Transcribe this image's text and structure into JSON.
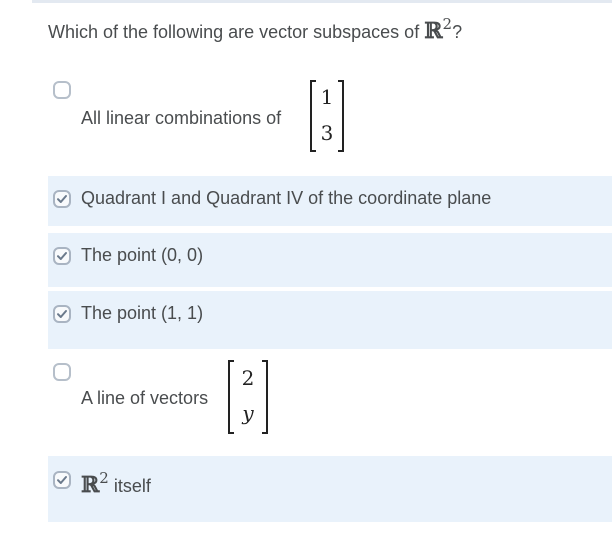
{
  "question": {
    "text": "Which of the following are vector subspaces of",
    "symbol": "ℝ",
    "exponent": "2",
    "suffix": "?"
  },
  "options": [
    {
      "label": "All linear combinations of",
      "checked": false,
      "selected": false,
      "vector": [
        "1",
        "3"
      ]
    },
    {
      "label": "Quadrant I and Quadrant IV of the coordinate plane",
      "checked": true,
      "selected": true
    },
    {
      "label": "The point (0, 0)",
      "checked": true,
      "selected": true
    },
    {
      "label": "The point (1, 1)",
      "checked": true,
      "selected": true
    },
    {
      "label": "A line of vectors",
      "checked": false,
      "selected": false,
      "vector": [
        "2",
        "y"
      ]
    },
    {
      "symbol": "ℝ",
      "exponent": "2",
      "label": "itself",
      "checked": true,
      "selected": true
    }
  ],
  "colors": {
    "selected_background": "#e9f2fb",
    "text": "#494c4e",
    "checkbox_border": "#b6bfca",
    "checkmark": "#6b7a8c"
  }
}
